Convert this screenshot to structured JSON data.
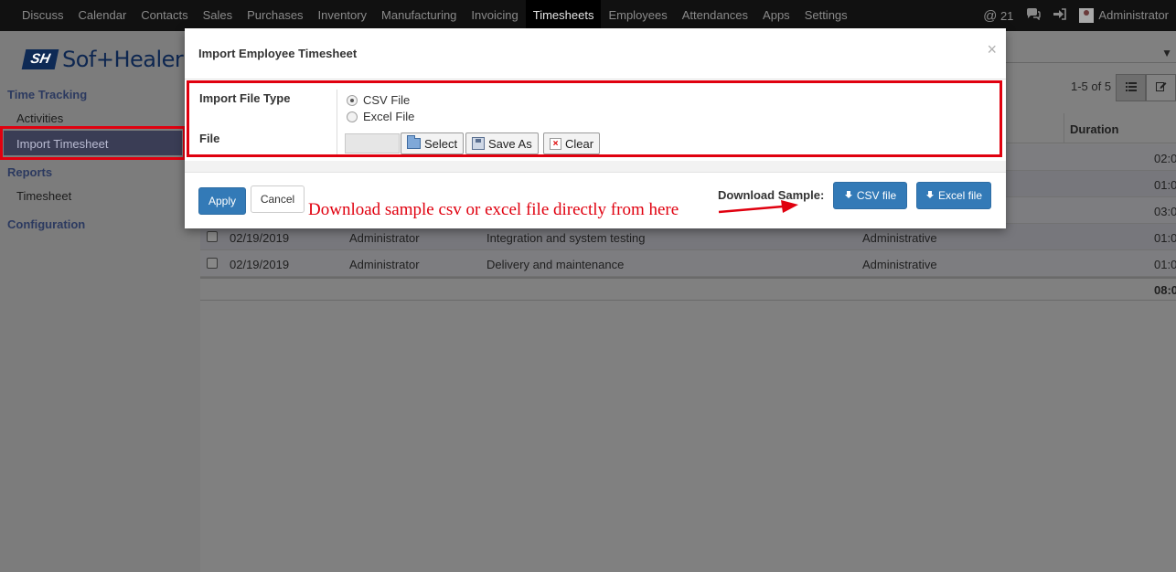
{
  "topbar": {
    "menu": [
      "Discuss",
      "Calendar",
      "Contacts",
      "Sales",
      "Purchases",
      "Inventory",
      "Manufacturing",
      "Invoicing",
      "Timesheets",
      "Employees",
      "Attendances",
      "Apps",
      "Settings"
    ],
    "active": "Timesheets",
    "mentions_count": "21",
    "user": "Administrator"
  },
  "sidebar": {
    "logo_text": "Sof+Healer",
    "time_tracking": "Time Tracking",
    "activities": "Activities",
    "import_timesheet": "Import Timesheet",
    "reports": "Reports",
    "timesheet": "Timesheet",
    "configuration": "Configuration"
  },
  "list": {
    "pager": "1-5 of 5",
    "duration_header": "Duration",
    "rows": [
      {
        "date": "",
        "user": "",
        "desc": "",
        "project": "",
        "duration": "02:0"
      },
      {
        "date": "",
        "user": "",
        "desc": "",
        "project": "",
        "duration": "01:0"
      },
      {
        "date": "",
        "user": "",
        "desc": "",
        "project": "",
        "duration": "03:0"
      },
      {
        "date": "02/19/2019",
        "user": "Administrator",
        "desc": "Integration and system testing",
        "project": "Administrative",
        "duration": "01:0"
      },
      {
        "date": "02/19/2019",
        "user": "Administrator",
        "desc": "Delivery and maintenance",
        "project": "Administrative",
        "duration": "01:0"
      }
    ],
    "total": "08:0"
  },
  "modal": {
    "title": "Import Employee Timesheet",
    "close": "×",
    "import_file_type_label": "Import File Type",
    "csv_option": "CSV File",
    "excel_option": "Excel File",
    "selected_type": "CSV File",
    "file_label": "File",
    "select_button": "Select",
    "save_as_button": "Save As",
    "clear_button": "Clear",
    "apply_button": "Apply",
    "cancel_button": "Cancel",
    "download_sample_label": "Download Sample:",
    "csv_file_button": "CSV file",
    "excel_file_button": "Excel file"
  },
  "annotation": {
    "text": "Download sample csv or excel file directly from here",
    "color": "#e0000f"
  },
  "colors": {
    "primary": "#337ab7",
    "highlight_border": "#e0000f",
    "navbar": "#111111"
  }
}
